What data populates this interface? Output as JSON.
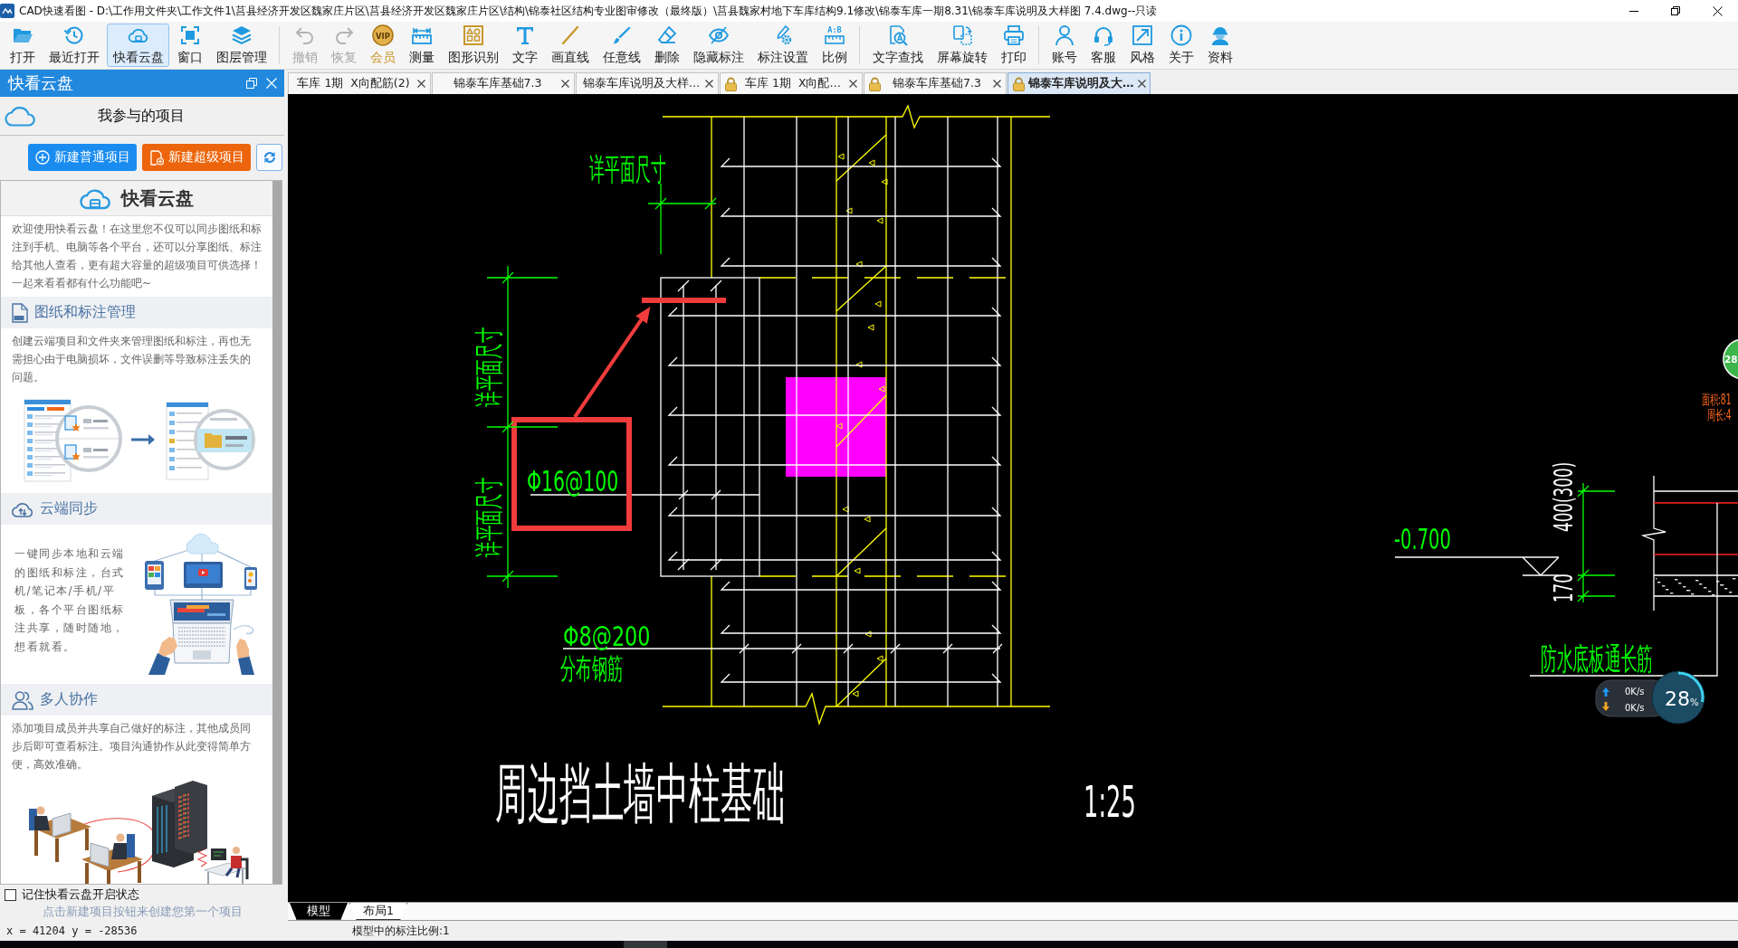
{
  "window": {
    "title": "CAD快速看图 - D:\\工作用文件夹\\工作文件1\\莒县经济开发区魏家庄片区\\莒县经济开发区魏家庄片区\\结构\\锦泰社区结构专业图审修改（最终版）\\莒县魏家村地下车库结构9.1修改\\锦泰车库一期8.31\\锦泰车库说明及大样图 7.4.dwg--只读"
  },
  "toolbar": {
    "groups": [
      [
        {
          "label": "打开",
          "selected": false,
          "disabled": false
        },
        {
          "label": "最近打开",
          "selected": false,
          "disabled": false
        },
        {
          "label": "快看云盘",
          "selected": true,
          "disabled": false
        },
        {
          "label": "窗口",
          "selected": false,
          "disabled": false
        },
        {
          "label": "图层管理",
          "selected": false,
          "disabled": false
        }
      ],
      [
        {
          "label": "撤销",
          "selected": false,
          "disabled": true
        },
        {
          "label": "恢复",
          "selected": false,
          "disabled": true
        },
        {
          "label": "会员",
          "selected": false,
          "disabled": false,
          "icon_text": "VIP"
        },
        {
          "label": "测量",
          "selected": false,
          "disabled": false
        },
        {
          "label": "图形识别",
          "selected": false,
          "disabled": false
        },
        {
          "label": "文字",
          "selected": false,
          "disabled": false
        },
        {
          "label": "画直线",
          "selected": false,
          "disabled": false
        },
        {
          "label": "任意线",
          "selected": false,
          "disabled": false
        },
        {
          "label": "删除",
          "selected": false,
          "disabled": false
        },
        {
          "label": "隐藏标注",
          "selected": false,
          "disabled": false
        },
        {
          "label": "标注设置",
          "selected": false,
          "disabled": false
        },
        {
          "label": "比例",
          "selected": false,
          "disabled": false,
          "icon_text": "A:B"
        }
      ],
      [
        {
          "label": "文字查找",
          "selected": false,
          "disabled": false,
          "icon_text": "A"
        },
        {
          "label": "屏幕旋转",
          "selected": false,
          "disabled": false
        },
        {
          "label": "打印",
          "selected": false,
          "disabled": false
        }
      ],
      [
        {
          "label": "账号",
          "selected": false,
          "disabled": false
        },
        {
          "label": "客服",
          "selected": false,
          "disabled": false
        },
        {
          "label": "风格",
          "selected": false,
          "disabled": false
        },
        {
          "label": "关于",
          "selected": false,
          "disabled": false
        },
        {
          "label": "资料",
          "selected": false,
          "disabled": false
        }
      ]
    ]
  },
  "sidebar": {
    "title": "快看云盘",
    "project_header": "我参与的项目",
    "buttons": [
      {
        "label": "新建普通项目",
        "kind": "normal"
      },
      {
        "label": "新建超级项目",
        "kind": "super"
      }
    ],
    "panel": {
      "heading": "快看云盘",
      "intro": [
        "欢迎使用快看云盘！在这里您不仅可以同步图纸和标",
        "注到手机、电脑等各个平台，还可以分享图纸、标注",
        "给其他人查看，更有超大容量的超级项目可供选择！",
        "一起来看看都有什么功能吧~"
      ],
      "sections": [
        {
          "title": "图纸和标注管理",
          "kind": "stacked",
          "lines": [
            "创建云端项目和文件夹来管理图纸和标注，再也无",
            "需担心由于电脑损坏，文件误删等导致标注丢失的",
            "问题。"
          ]
        },
        {
          "title": "云端同步",
          "kind": "side",
          "lines": [
            "一键同步本地和云端",
            "的图纸和标注，台式",
            "机/笔记本/手机/平",
            "板，各个平台图纸标",
            "注共享，随时随地，",
            "想看就看。"
          ]
        },
        {
          "title": "多人协作",
          "kind": "stacked",
          "lines": [
            "添加项目成员并共享自己做好的标注，其他成员同",
            "步后即可查看标注。项目沟通协作从此变得简单方",
            "便，高效准确。"
          ]
        }
      ]
    },
    "remember": {
      "label": "记住快看云盘开启状态",
      "checked": false
    },
    "hint": "点击新建项目按钮来创建您第一个项目"
  },
  "doc_tabs": [
    {
      "label": "车库 1期  X向配筋(2)",
      "locked": false,
      "selected": false
    },
    {
      "label": "锦泰车库基础7.3",
      "locked": false,
      "selected": false
    },
    {
      "label": "锦泰车库说明及大样…",
      "locked": false,
      "selected": false
    },
    {
      "label": "车库 1期  X向配…",
      "locked": true,
      "selected": false
    },
    {
      "label": "锦泰车库基础7.3",
      "locked": true,
      "selected": false
    },
    {
      "label": "锦泰车库说明及大…",
      "locked": true,
      "selected": true
    }
  ],
  "canvas": {
    "labels": [
      {
        "text": "详平面尺寸",
        "kind": "note"
      },
      {
        "text": "详平面尺寸",
        "kind": "note"
      },
      {
        "text": "详平面尺寸",
        "kind": "note"
      },
      {
        "text": "Φ16@100",
        "kind": "note"
      },
      {
        "text": "Φ8@200",
        "kind": "note"
      },
      {
        "text": "分布钢筋",
        "kind": "note"
      },
      {
        "text": "周边挡土墙中柱基础",
        "kind": "title"
      },
      {
        "text": "1:25",
        "kind": "scale"
      },
      {
        "text": "-0.700",
        "kind": "note"
      },
      {
        "text": "400(300)",
        "kind": "dimension"
      },
      {
        "text": "170",
        "kind": "dimension"
      },
      {
        "text": "防水底板通长筋",
        "kind": "note"
      },
      {
        "text": "面积:81",
        "kind": "measure"
      },
      {
        "text": "周长:4",
        "kind": "measure"
      }
    ],
    "badge": "28",
    "net_monitor": {
      "upload": "0K/s",
      "download": "0K/s",
      "value": "28",
      "unit": "%"
    }
  },
  "layout_tabs": [
    {
      "label": "模型",
      "selected": true
    },
    {
      "label": "布局1",
      "selected": false
    }
  ],
  "status_bar": {
    "coordinates": "x = 41204 y = -28536",
    "annotation_scale": "模型中的标注比例:1"
  }
}
